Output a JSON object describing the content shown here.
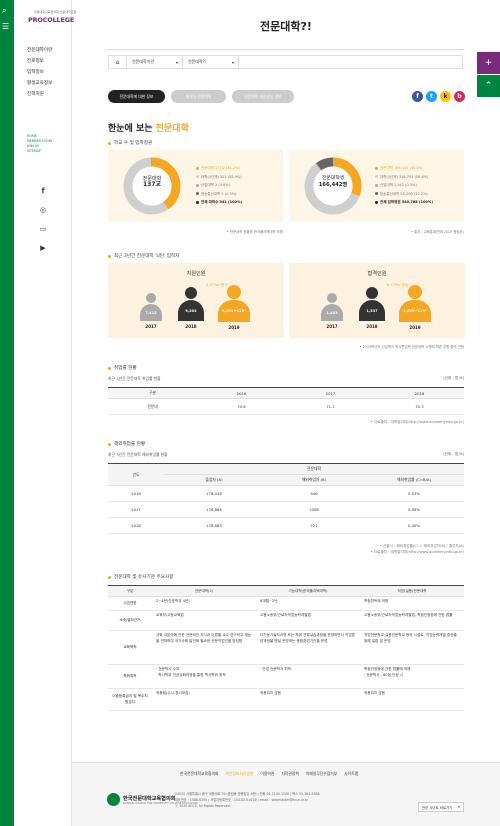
{
  "sidebar": {
    "logo_sub": "전문대학교육협의회 전문대학포털",
    "logo_text": "PROCOLLEGE",
    "menu": [
      "전문대학이란",
      "진로정보",
      "입학정보",
      "평생교육정보",
      "진학지원"
    ],
    "links": [
      "HOME",
      "MEMBER LOGIN",
      "JOIN US",
      "SITEMAP"
    ],
    "social": [
      "f",
      "◎",
      "▭",
      "▶"
    ]
  },
  "header": {
    "title": "전문대학?!",
    "crumb": [
      "전문대학이란",
      "전문대학?!"
    ]
  },
  "tabs": [
    "전문대학에 대한 정보",
    "재직자 전문대학",
    "전문대학 비전문인 정보"
  ],
  "shares": [
    "f",
    "t",
    "k",
    "b"
  ],
  "colors": {
    "green": "#00853e",
    "purple": "#7a2a7a",
    "orange": "#f5a623",
    "dark": "#222222",
    "gray": "#cccccc"
  },
  "heading": {
    "pre": "한눈에 보는 ",
    "accent": "전문대학"
  },
  "sec1": {
    "title": "학교 수 및 입학정원",
    "left": {
      "center_1": "전문대학",
      "center_2": "137교",
      "legend": [
        "전문대학 137교 (41.2%)",
        "대학(4년제) 201 (58.9%)",
        "산업대학 2 (0.6%)",
        "방송통신대학 1 (0.3%)",
        "전체 대학수 341 (100%)"
      ],
      "note": "• 전문대학 현황에 한국폴리텍대학 포함"
    },
    "right": {
      "center_1": "전문대학생",
      "center_2": "166,442명",
      "legend": [
        "전문대학 166,442 (30.8%)",
        "대학(4년제) 316,704 (58.6%)",
        "산업대학 2,442 (0.5%)",
        "방송통신대학 55,200 (10.2%)",
        "전체 입학정원 540,788 (100%)"
      ],
      "note": "• 출처 : 교육통계연보(2019 평정본)"
    }
  },
  "chart_data": [
    {
      "type": "pie",
      "title": "",
      "categories": [
        "전문대학",
        "대학(4년제)",
        "산업대학",
        "방송통신대학"
      ],
      "values": [
        137,
        201,
        2,
        1
      ],
      "total": 341
    },
    {
      "type": "pie",
      "title": "",
      "categories": [
        "전문대학",
        "대학(4년제)",
        "산업대학",
        "방송통신대학"
      ],
      "values": [
        166442,
        316704,
        2442,
        55200
      ],
      "total": 540788
    }
  ],
  "sec2": {
    "title": "최근 3년간 전문대학 'U턴' 입학자",
    "left": {
      "title": "지원인원",
      "growth": "4.27%p 증가",
      "people": [
        {
          "value": "7,412",
          "year": "2017"
        },
        {
          "value": "9,202",
          "year": "2018"
        },
        {
          "value": "8,391+418*",
          "year": "2019"
        }
      ]
    },
    "right": {
      "title": "합격인원",
      "growth": "6.77%p 상승",
      "people": [
        {
          "value": "1,453",
          "year": "2017"
        },
        {
          "value": "1,537",
          "year": "2018"
        },
        {
          "value": "1,525+115*",
          "year": "2019"
        }
      ]
    },
    "note": "• 2019학년도 신입학자 학사편입학 전문대학 시행에 따른 지원·합격 인원"
  },
  "sec3": {
    "title": "취업률 현황",
    "sub": "최근 3년간 전문대학 취업률 현황",
    "unit": "(단위 : 명,%)",
    "headers": [
      "구분",
      "2016",
      "2017",
      "2018"
    ],
    "row": [
      "전문대",
      "70.6",
      "71.1",
      "70.3"
    ],
    "source": "• 자료출처 : 대학알리미(http://www.academyinfo.go.kr)"
  },
  "sec4": {
    "title": "해외취업률 현황",
    "sub": "최근 3년간 전문대학 해외취업률 현황",
    "unit": "(단위 : 명,%)",
    "group": "전문대학",
    "headers": [
      "년도",
      "졸업자 (A)",
      "해외취업자 (B)",
      "해외취업률 (C=B/A)"
    ],
    "rows": [
      [
        "2016",
        "178,026",
        "946",
        "0.53%"
      ],
      [
        "2017",
        "176,664",
        "1098",
        "0.59%"
      ],
      [
        "2018",
        "178,583",
        "721",
        "0.40%"
      ]
    ],
    "note1": "• 산출식 : 해외취업률(C) = 해외취업자(B) / 졸업자(A)",
    "note2": "• 자료출처 : 대학알리미(http://www.academyinfo.go.kr)"
  },
  "sec5": {
    "title": "전문대학 및 유사기관 주요사항",
    "headers": [
      "구분",
      "전문대학(2)",
      "기능대학(한국폴리텍대학)",
      "직업(실용)전문대학"
    ],
    "rows": [
      [
        "수업연한",
        "2~4년(간호학과 4년)",
        "6개월~2년",
        "학점취득에 의함"
      ],
      [
        "소속/설치근거",
        "교육부/고등교육법",
        "고용노동부/근로자직업능력개발법",
        "고용노동부/근로자직업능력개발법, 학점인정등에 관한 법률"
      ],
      [
        "교육목적",
        "사회 각분야에 관한 전문적인 지식과 이론을 교수·연구하고 재능을 연마하여 국가사회 발전에 필요한 전문직업인을 양성함",
        "다기능기술자과정 또는 학위 연결실습과정을 운영하면서 직업훈련과정을 병설 운영하는 종합훈련기관을 운영",
        "직업전문학교 실용전문학교 등의 시설로, 직업능력개발 훈련을 위해 설립 및 운영"
      ],
      [
        "학위취득",
        "· 전문학사 수여\n· 학사학위 전공심화과정을 통한 학사학위 취득",
        "· 산업 전문학사 취득",
        "학점인정등에 관한 법률에 의해\n· 전문학사 : 80점 인정 시"
      ],
      [
        "이중등록금지 및 복수지원금지",
        "적용됨(수시,정시모집)",
        "적용되지 않음",
        "적용되지 않음"
      ]
    ]
  },
  "footer": {
    "links": [
      "한국전문대학교육협의회",
      "개인정보처리방침",
      "이용약관",
      "저작권정책",
      "이메일무단수집거부",
      "사이트맵"
    ],
    "org": "한국전문대학교육협의회",
    "org_en": "KOREAN COUNCIL FOR UNIVERSITY COLLEGE EDUCATION",
    "addr": [
      "04520 서울특별시 중구 세종대로 39 (중림동 영봉빌딩 4층) | 전화 02-2145-1200 | 팩스 02-364-9386",
      "대표번호 : 1588-6350 | 사업자등록번호 : 104-82-51616 | email : webmaster@kcce.or.kr",
      "ⓒ 2020 KCCE. All Rights Reserved."
    ],
    "site_select": "관련 사이트 바로가기"
  }
}
